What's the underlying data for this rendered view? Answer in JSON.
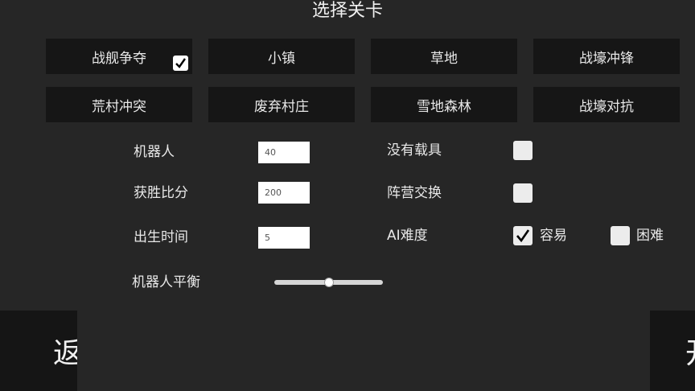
{
  "title": "选择关卡",
  "levels": [
    {
      "label": "战舰争夺",
      "selected": true
    },
    {
      "label": "小镇",
      "selected": false
    },
    {
      "label": "草地",
      "selected": false
    },
    {
      "label": "战壕冲锋",
      "selected": false
    },
    {
      "label": "荒村冲突",
      "selected": false
    },
    {
      "label": "废弃村庄",
      "selected": false
    },
    {
      "label": "雪地森林",
      "selected": false
    },
    {
      "label": "战壕对抗",
      "selected": false
    }
  ],
  "settings": {
    "bots": {
      "label": "机器人",
      "value": "40"
    },
    "win_score": {
      "label": "获胜比分",
      "value": "200"
    },
    "spawn_time": {
      "label": "出生时间",
      "value": "5"
    },
    "bot_balance": {
      "label": "机器人平衡",
      "value": 0.5
    },
    "no_vehicles": {
      "label": "没有载具",
      "checked": false
    },
    "swap_factions": {
      "label": "阵营交换",
      "checked": false
    },
    "ai_difficulty": {
      "label": "AI难度",
      "easy": {
        "label": "容易",
        "checked": true
      },
      "hard": {
        "label": "困难",
        "checked": false
      }
    }
  },
  "buttons": {
    "back": "返回",
    "start": "开始"
  }
}
